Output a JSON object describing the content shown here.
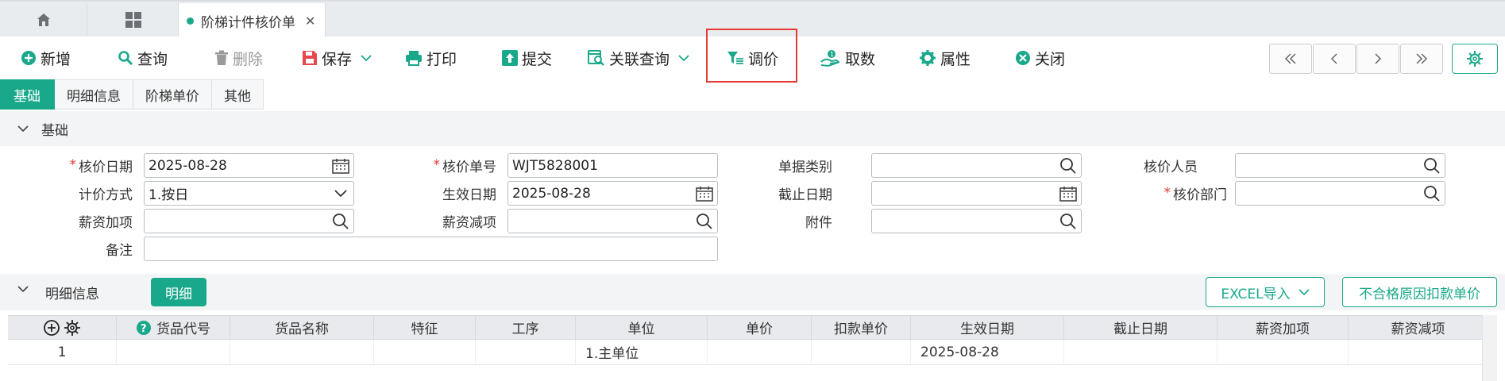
{
  "tabs": {
    "home_icon": "home-icon",
    "apps_icon": "grid-icon",
    "doc_tab_label": "阶梯计件核价单",
    "close_glyph": "✕"
  },
  "toolbar": {
    "new_label": "新增",
    "query_label": "查询",
    "delete_label": "删除",
    "save_label": "保存",
    "print_label": "打印",
    "submit_label": "提交",
    "related_query_label": "关联查询",
    "adjust_price_label": "调价",
    "fetch_label": "取数",
    "property_label": "属性",
    "close_label": "关闭"
  },
  "subtabs": [
    "基础",
    "明细信息",
    "阶梯单价",
    "其他"
  ],
  "sections": {
    "basic_title": "基础",
    "detail_title": "明细信息"
  },
  "form": {
    "price_date_label": "核价日期",
    "price_date_value": "2025-08-28",
    "price_no_label": "核价单号",
    "price_no_value": "WJT5828001",
    "doc_type_label": "单据类别",
    "doc_type_value": "",
    "pricer_label": "核价人员",
    "pricer_value": "",
    "pricing_method_label": "计价方式",
    "pricing_method_value": "1.按日",
    "effective_date_label": "生效日期",
    "effective_date_value": "2025-08-28",
    "end_date_label": "截止日期",
    "end_date_value": "",
    "price_dept_label": "核价部门",
    "price_dept_value": "",
    "salary_add_label": "薪资加项",
    "salary_add_value": "",
    "salary_deduct_label": "薪资减项",
    "salary_deduct_value": "",
    "attachment_label": "附件",
    "attachment_value": "",
    "remark_label": "备注",
    "remark_value": ""
  },
  "detail": {
    "detail_button": "明细",
    "excel_import": "EXCEL导入",
    "reason_button": "不合格原因扣款单价"
  },
  "grid": {
    "columns": [
      "货品代号",
      "货品名称",
      "特征",
      "工序",
      "单位",
      "单价",
      "扣款单价",
      "生效日期",
      "截止日期",
      "薪资加项",
      "薪资减项"
    ],
    "rows": [
      {
        "index": "1",
        "product_code": "",
        "product_name": "",
        "feature": "",
        "process": "",
        "unit": "1.主单位",
        "unit_price": "",
        "deduct_price": "",
        "effective_date": "2025-08-28",
        "end_date": "",
        "salary_add": "",
        "salary_deduct": ""
      }
    ]
  },
  "colors": {
    "accent": "#1aa88a",
    "required": "#e53935",
    "save_icon": "#e5484d",
    "highlight": "#e53935"
  }
}
